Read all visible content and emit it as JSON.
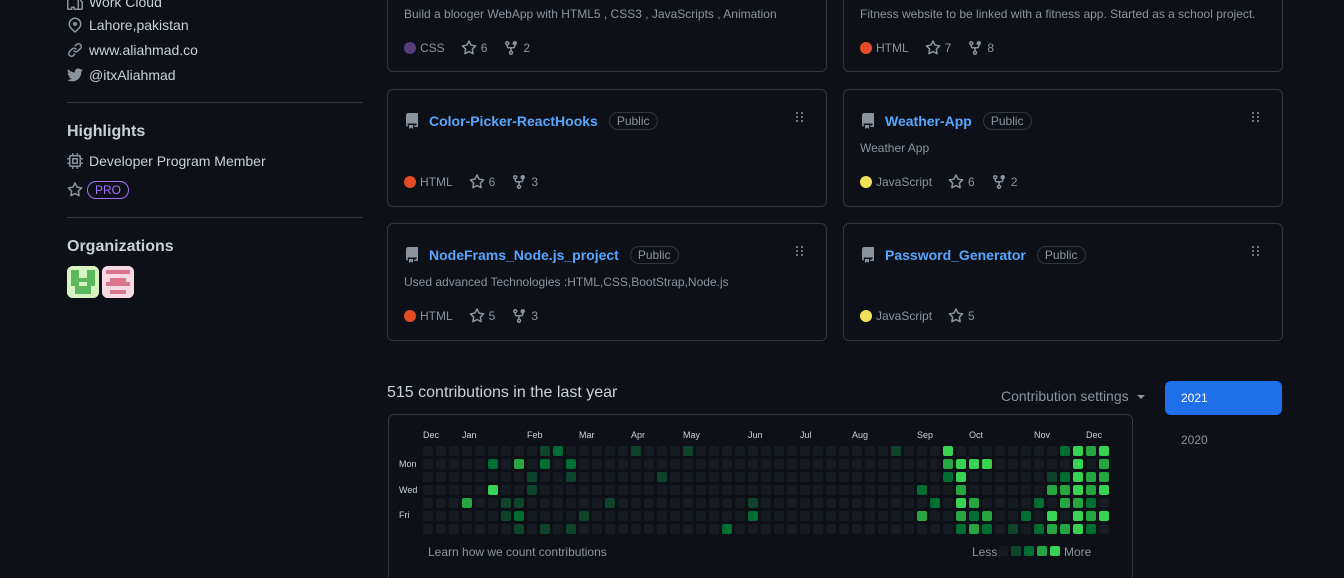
{
  "sidebar": {
    "company": "Work Cloud",
    "location": "Lahore,pakistan",
    "website": "www.aliahmad.co",
    "twitter": "@itxAliahmad",
    "highlights_title": "Highlights",
    "highlight_dev": "Developer Program Member",
    "highlight_pro": "PRO",
    "orgs_title": "Organizations"
  },
  "repos": [
    {
      "name": "",
      "badge": "",
      "desc": "Build a blooger WebApp with HTML5 , CSS3 , JavaScripts , Animation",
      "lang": "CSS",
      "lang_color": "#563d7c",
      "stars": "6",
      "forks": "2"
    },
    {
      "name": "",
      "badge": "",
      "desc": "Fitness website to be linked with a fitness app. Started as a school project.",
      "lang": "HTML",
      "lang_color": "#e34c26",
      "stars": "7",
      "forks": "8"
    },
    {
      "name": "Color-Picker-ReactHooks",
      "badge": "Public",
      "desc": "",
      "lang": "HTML",
      "lang_color": "#e34c26",
      "stars": "6",
      "forks": "3"
    },
    {
      "name": "Weather-App",
      "badge": "Public",
      "desc": "Weather App",
      "lang": "JavaScript",
      "lang_color": "#f1e05a",
      "stars": "6",
      "forks": "2"
    },
    {
      "name": "NodeFrams_Node.js_project",
      "badge": "Public",
      "desc": "Used advanced Technologies :HTML,CSS,BootStrap,Node.js",
      "lang": "HTML",
      "lang_color": "#e34c26",
      "stars": "5",
      "forks": "3"
    },
    {
      "name": "Password_Generator",
      "badge": "Public",
      "desc": "",
      "lang": "JavaScript",
      "lang_color": "#f1e05a",
      "stars": "5",
      "forks": ""
    }
  ],
  "contributions": {
    "title": "515 contributions in the last year",
    "settings": "Contribution settings",
    "months": [
      "Dec",
      "Jan",
      "Feb",
      "Mar",
      "Apr",
      "May",
      "Jun",
      "Jul",
      "Aug",
      "Sep",
      "Oct",
      "Nov",
      "Dec"
    ],
    "days": [
      "Mon",
      "Wed",
      "Fri"
    ],
    "learn": "Learn how we count contributions",
    "less": "Less",
    "more": "More",
    "colors": [
      "#161b22",
      "#0e4429",
      "#006d32",
      "#26a641",
      "#39d353"
    ]
  },
  "years": [
    "2021",
    "2020"
  ]
}
